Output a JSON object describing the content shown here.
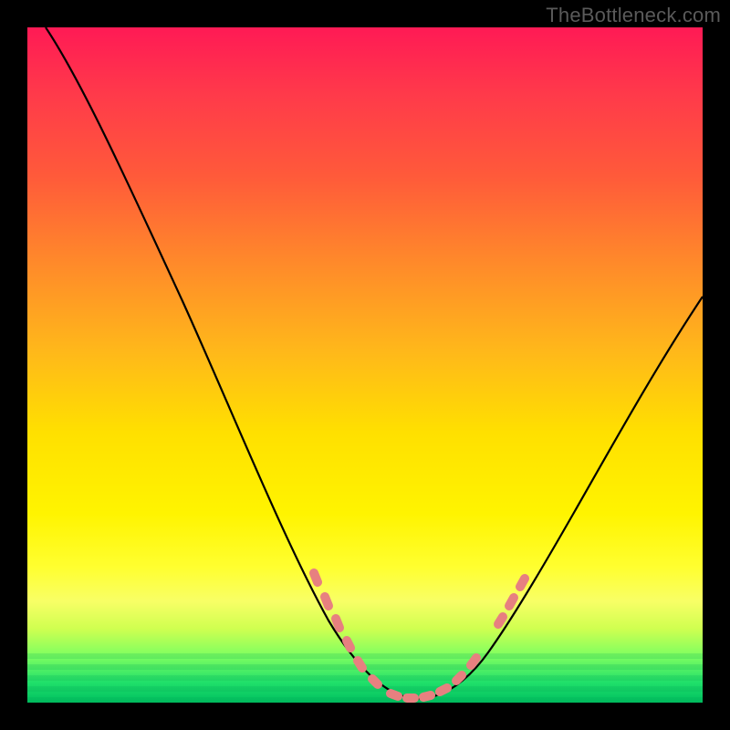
{
  "watermark": {
    "text": "TheBottleneck.com"
  },
  "chart_data": {
    "type": "line",
    "title": "",
    "xlabel": "",
    "ylabel": "",
    "xlim": [
      0,
      100
    ],
    "ylim": [
      0,
      100
    ],
    "grid": false,
    "legend": false,
    "colors": {
      "background_gradient": [
        "#ff1a55",
        "#ff5a3a",
        "#ffb81a",
        "#ffff30",
        "#80ff60",
        "#00c060"
      ],
      "curve": "#000000",
      "markers": "#e78080"
    },
    "series": [
      {
        "name": "bottleneck-curve",
        "x": [
          3,
          10,
          18,
          26,
          34,
          40,
          44,
          47,
          49,
          51,
          53,
          56,
          59,
          62,
          64,
          67,
          70,
          73,
          77,
          82,
          88,
          94,
          100
        ],
        "y": [
          100,
          88,
          74,
          60,
          46,
          34,
          24,
          14,
          8,
          4,
          1,
          0,
          0,
          1,
          3,
          6,
          10,
          14,
          20,
          28,
          38,
          49,
          60
        ]
      }
    ],
    "markers": {
      "name": "highlighted-points",
      "shape": "capsule",
      "x": [
        44,
        46,
        48,
        50,
        52,
        55,
        57,
        59,
        61,
        63,
        65,
        67,
        69,
        70,
        71
      ],
      "y": [
        24,
        18,
        12,
        6,
        2,
        0,
        0,
        0,
        1,
        3,
        5,
        8,
        12,
        14,
        17
      ]
    }
  }
}
